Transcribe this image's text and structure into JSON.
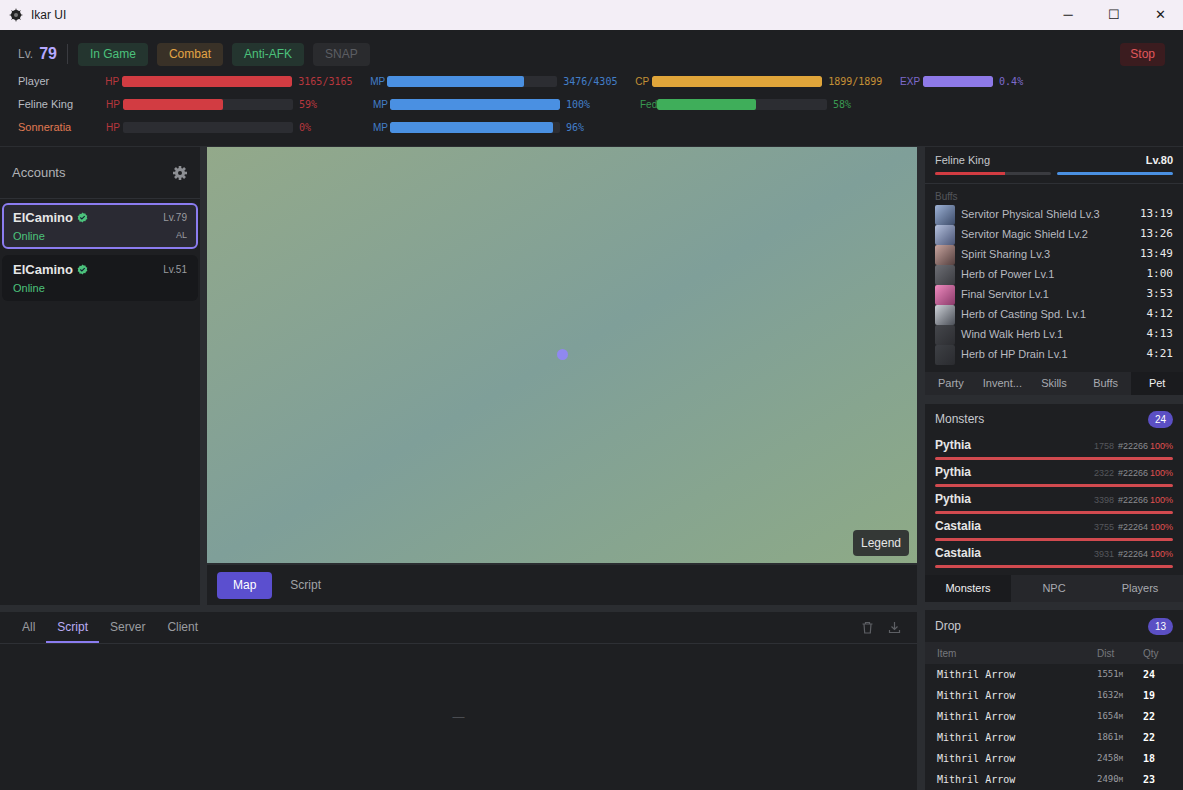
{
  "window": {
    "title": "Ikar UI",
    "controls": [
      "─",
      "☐",
      "✕"
    ]
  },
  "header": {
    "level_label": "Lv.",
    "level": "79",
    "badges": [
      {
        "label": "In Game",
        "color": "#4cc27c",
        "disabled": false
      },
      {
        "label": "Combat",
        "color": "#e2a445",
        "disabled": false
      },
      {
        "label": "Anti-AFK",
        "color": "#4cc27c",
        "disabled": false
      },
      {
        "label": "SNAP",
        "color": "#5c5e63",
        "disabled": true
      }
    ],
    "stop": "Stop"
  },
  "stats": [
    {
      "name": "Player",
      "color": "#b9bcc2",
      "bars": [
        {
          "label": "HP",
          "value": "3165/3165",
          "level": 1,
          "color": "#d23c42"
        },
        {
          "label": "MP",
          "value": "3476/4305",
          "level": 0.807,
          "color": "#4a90e2"
        },
        {
          "label": "CP",
          "value": "1899/1899",
          "level": 1,
          "color": "#e0a53a"
        },
        {
          "label": "EXP",
          "value": "0.4%",
          "level": 1,
          "color": "#8e79e8"
        }
      ]
    },
    {
      "name": "Feline King",
      "color": "#b9bcc2",
      "bars": [
        {
          "label": "HP",
          "value": "59%",
          "level": 0.59,
          "color": "#d23c42"
        },
        {
          "label": "MP",
          "value": "100%",
          "level": 1,
          "color": "#4a90e2"
        },
        {
          "label": "Fed",
          "value": "58%",
          "level": 0.58,
          "color": "#3fae5a"
        }
      ]
    },
    {
      "name": "Sonneratia",
      "color": "#e07a52",
      "bars": [
        {
          "label": "HP",
          "value": "0%",
          "level": 0,
          "color": "#d23c42"
        },
        {
          "label": "MP",
          "value": "96%",
          "level": 0.96,
          "color": "#4a90e2"
        }
      ]
    }
  ],
  "sidebar": {
    "title": "Accounts",
    "accounts": [
      {
        "name": "ElCamino",
        "status": "Online",
        "level": "Lv.79",
        "tag": "AL",
        "selected": true
      },
      {
        "name": "ElCamino",
        "status": "Online",
        "level": "Lv.51",
        "selected": false
      }
    ]
  },
  "map": {
    "legend": "Legend",
    "tabs": [
      {
        "label": "Map",
        "selected": true
      },
      {
        "label": "Script",
        "selected": false
      }
    ]
  },
  "log": {
    "tabs": [
      {
        "label": "All",
        "selected": false
      },
      {
        "label": "Script",
        "selected": true
      },
      {
        "label": "Server",
        "selected": false
      },
      {
        "label": "Client",
        "selected": false
      }
    ],
    "empty": "—"
  },
  "pet": {
    "name": "Feline King",
    "level": "Lv.80",
    "hp_level": 0.6,
    "mp_level": 1,
    "buffs_title": "Buffs",
    "buffs": [
      {
        "name": "Servitor Physical Shield Lv.3",
        "time": "13:19"
      },
      {
        "name": "Servitor Magic Shield Lv.2",
        "time": "13:26"
      },
      {
        "name": "Spirit Sharing Lv.3",
        "time": "13:49"
      },
      {
        "name": "Herb of Power Lv.1",
        "time": "1:00"
      },
      {
        "name": "Final Servitor Lv.1",
        "time": "3:53"
      },
      {
        "name": "Herb of Casting Spd. Lv.1",
        "time": "4:12"
      },
      {
        "name": "Wind Walk Herb Lv.1",
        "time": "4:13"
      },
      {
        "name": "Herb of HP Drain Lv.1",
        "time": "4:21"
      }
    ],
    "tabs": [
      {
        "label": "Party",
        "selected": false
      },
      {
        "label": "Invent...",
        "selected": false
      },
      {
        "label": "Skills",
        "selected": false
      },
      {
        "label": "Buffs",
        "selected": false
      },
      {
        "label": "Pet",
        "selected": true
      }
    ]
  },
  "monsters": {
    "title": "Monsters",
    "count": "24",
    "rows": [
      {
        "name": "Pythia",
        "hp": "1758",
        "id": "#22266",
        "pct": "100%",
        "level": 1
      },
      {
        "name": "Pythia",
        "hp": "2322",
        "id": "#22266",
        "pct": "100%",
        "level": 1
      },
      {
        "name": "Pythia",
        "hp": "3398",
        "id": "#22266",
        "pct": "100%",
        "level": 1
      },
      {
        "name": "Castalia",
        "hp": "3755",
        "id": "#22264",
        "pct": "100%",
        "level": 1
      },
      {
        "name": "Castalia",
        "hp": "3931",
        "id": "#22264",
        "pct": "100%",
        "level": 1
      }
    ],
    "tabs": [
      {
        "label": "Monsters",
        "selected": true
      },
      {
        "label": "NPC",
        "selected": false
      },
      {
        "label": "Players",
        "selected": false
      }
    ]
  },
  "drop": {
    "title": "Drop",
    "count": "13",
    "columns": [
      "Item",
      "Dist",
      "Qty"
    ],
    "rows": [
      {
        "item": "Mithril Arrow",
        "dist": "1551",
        "unit": "M",
        "qty": "24"
      },
      {
        "item": "Mithril Arrow",
        "dist": "1632",
        "unit": "M",
        "qty": "19"
      },
      {
        "item": "Mithril Arrow",
        "dist": "1654",
        "unit": "M",
        "qty": "22"
      },
      {
        "item": "Mithril Arrow",
        "dist": "1861",
        "unit": "M",
        "qty": "22"
      },
      {
        "item": "Mithril Arrow",
        "dist": "2458",
        "unit": "M",
        "qty": "18"
      },
      {
        "item": "Mithril Arrow",
        "dist": "2490",
        "unit": "M",
        "qty": "23"
      }
    ]
  }
}
